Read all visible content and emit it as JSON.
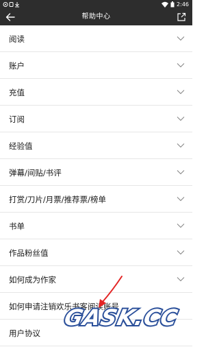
{
  "status_bar": {
    "time": "2:46",
    "left_icons": [
      "settings-icon",
      "device-icon",
      "download-icon"
    ],
    "right_icons": [
      "wifi-icon",
      "battery-icon"
    ]
  },
  "header": {
    "title": "帮助中心",
    "back_icon": "back-arrow-icon",
    "share_icon": "share-icon"
  },
  "help_items": [
    {
      "label": "阅读"
    },
    {
      "label": "账户"
    },
    {
      "label": "充值"
    },
    {
      "label": "订阅"
    },
    {
      "label": "经验值"
    },
    {
      "label": "弹幕/间贴/书评"
    },
    {
      "label": "打赏/刀片/月票/推荐票/榜单"
    },
    {
      "label": "书单"
    },
    {
      "label": "作品粉丝值"
    },
    {
      "label": "如何成为作家"
    },
    {
      "label": "如何申请注销欢乐书客阅读账号"
    },
    {
      "label": "用户协议"
    }
  ],
  "watermark": {
    "text": "GASK.CC",
    "colors": {
      "primary": "#2a4f9a",
      "accent": "#e33232"
    }
  },
  "annotation": {
    "color": "#e32424"
  }
}
